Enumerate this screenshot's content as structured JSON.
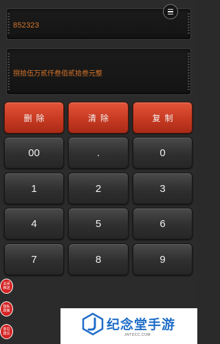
{
  "display": {
    "number": "852323",
    "words": "捌拾伍万贰仟叁佰贰拾叁元整"
  },
  "actions": {
    "delete_label": "删除",
    "clear_label": "清除",
    "copy_label": "复制"
  },
  "keypad": {
    "k00": "00",
    "kdot": ".",
    "k0": "0",
    "k1": "1",
    "k2": "2",
    "k3": "3",
    "k4": "4",
    "k5": "5",
    "k6": "6",
    "k7": "7",
    "k8": "8",
    "k9": "9"
  },
  "side_buttons": {
    "about": "关闭\n推送",
    "privacy": "隐私\n政策",
    "feedback": "意见\n建议"
  },
  "watermark": {
    "title": "纪念堂手游",
    "subtitle": "JNTDCC.COM"
  },
  "colors": {
    "accent_red": "#c73a22",
    "display_text": "#d9762a",
    "watermark_blue": "#1f6dc8"
  },
  "icons": {
    "menu": "menu-icon",
    "logo": "j-logo-icon"
  }
}
